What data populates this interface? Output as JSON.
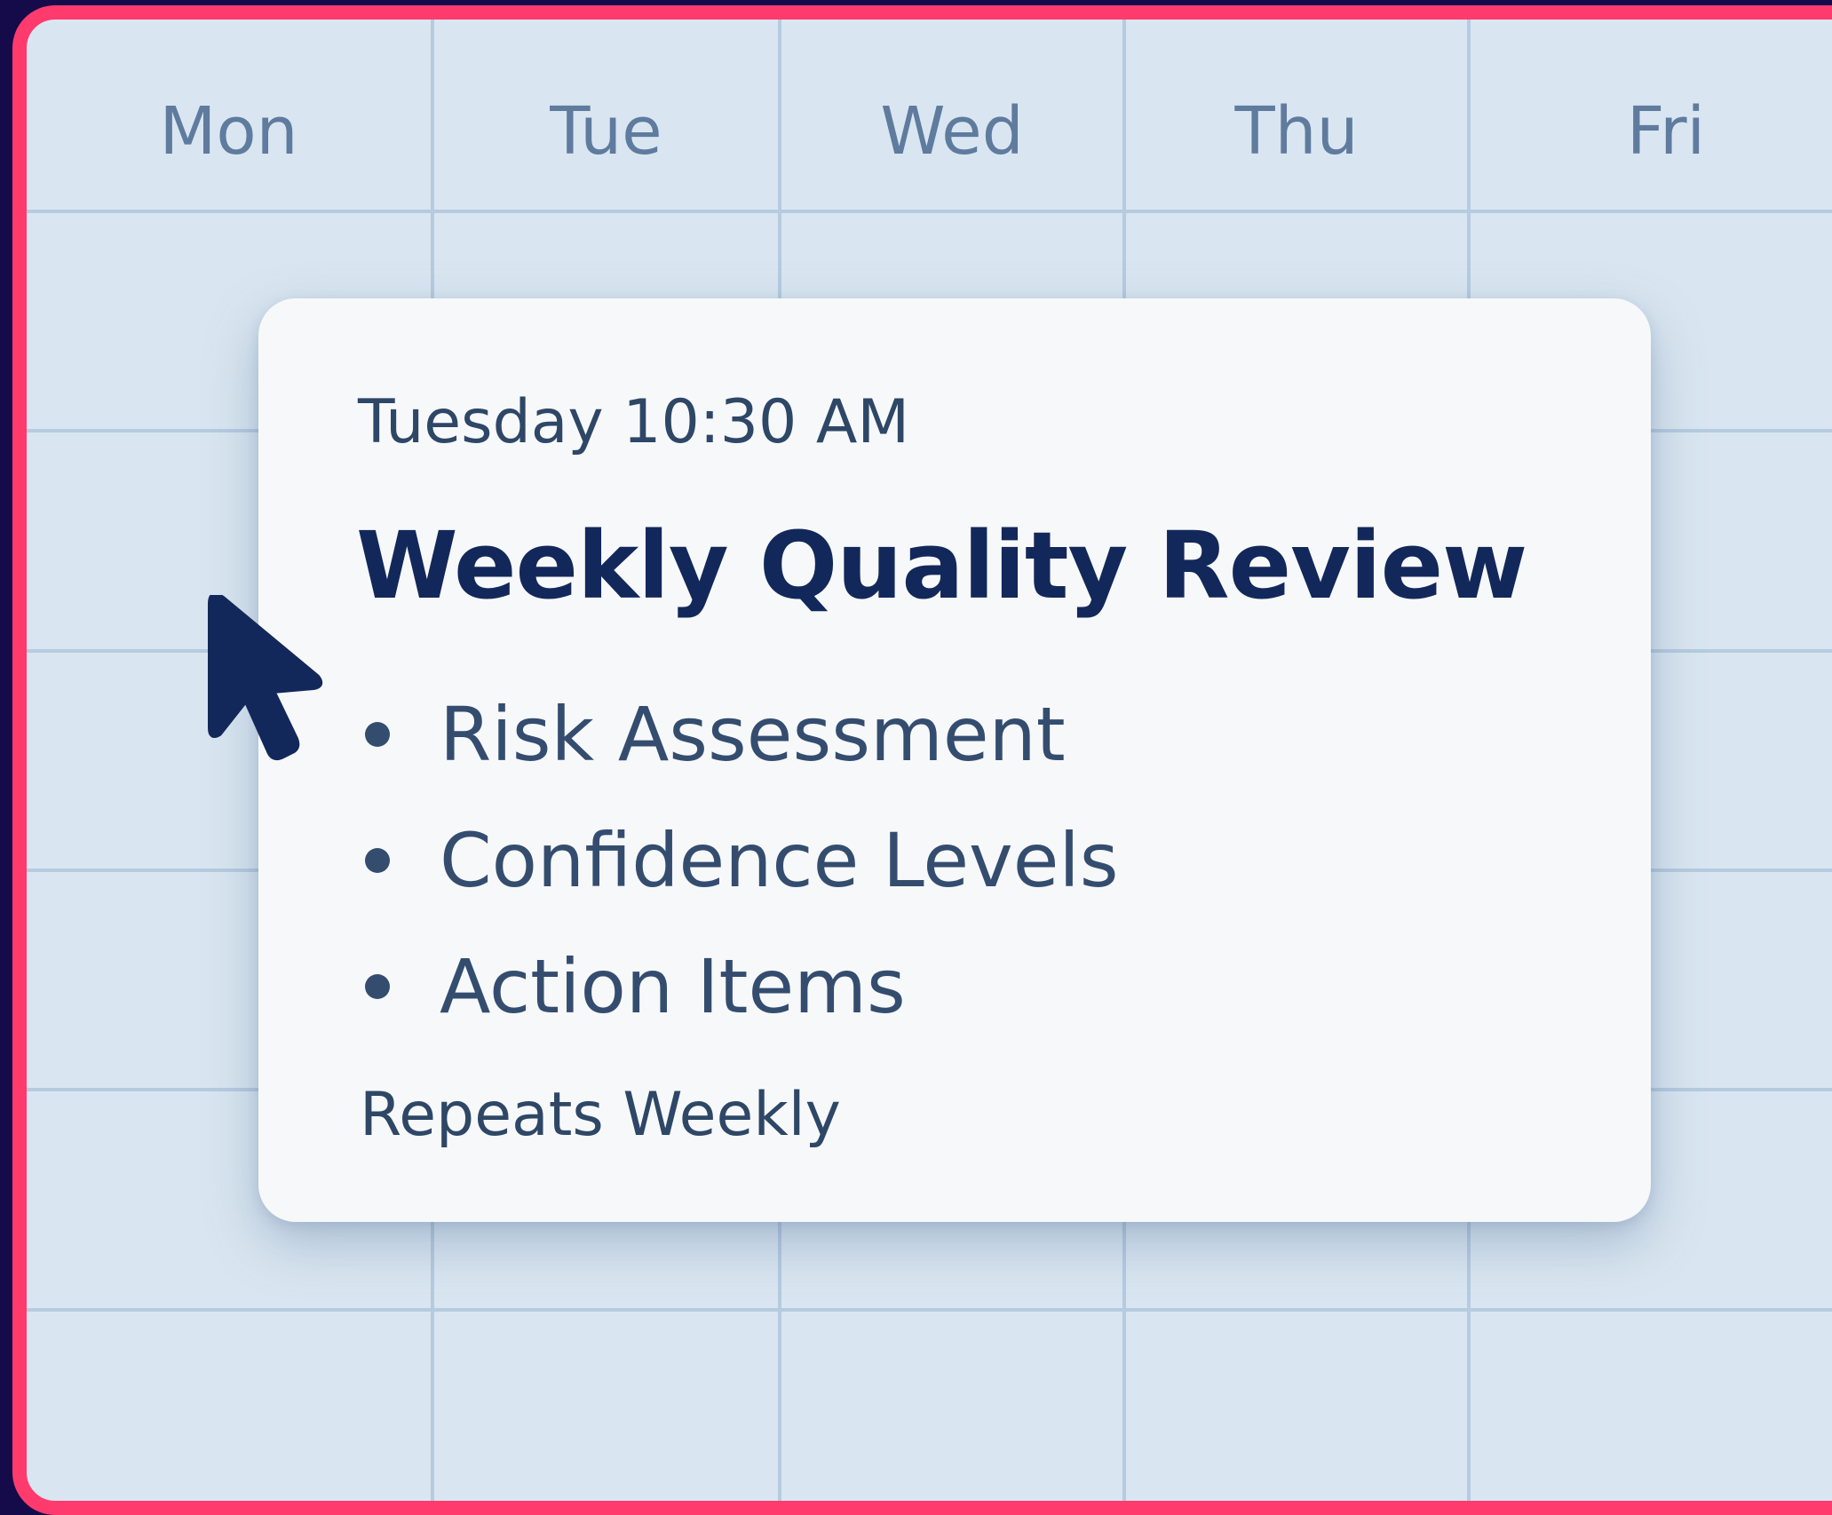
{
  "calendar": {
    "days": [
      "Mon",
      "Tue",
      "Wed",
      "Thu",
      "Fri"
    ]
  },
  "event": {
    "time": "Tuesday 10:30 AM",
    "title": "Weekly Quality Review",
    "agenda": [
      "Risk Assessment",
      "Confidence Levels",
      "Action Items"
    ],
    "recurrence": "Repeats Weekly"
  },
  "icons": {
    "cursor": "mouse-pointer-icon",
    "bullet": "bullet-dot-icon"
  },
  "colors": {
    "frame_border": "#ff3b6e",
    "background": "#150b4a",
    "calendar_bg": "#d9e6f1",
    "grid_line": "#b6cbe0",
    "card_bg": "#f7f8fa",
    "title_text": "#13285a",
    "cursor": "#13285a"
  }
}
